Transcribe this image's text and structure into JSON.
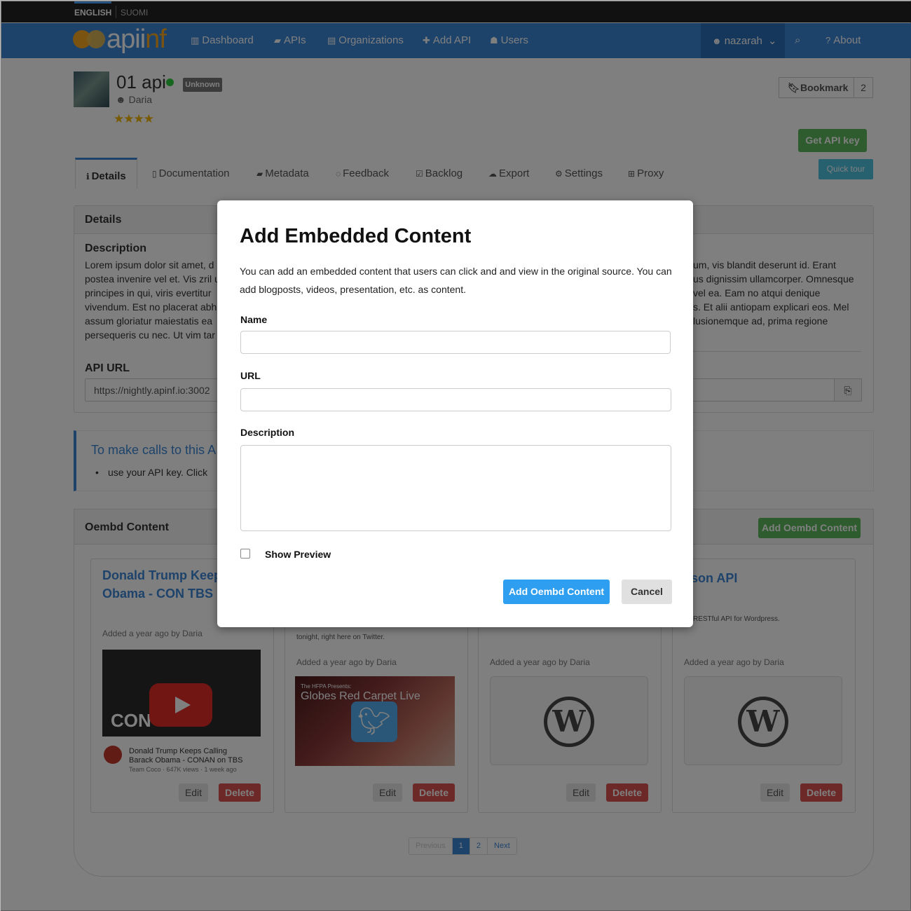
{
  "languages": {
    "english": "ENGLISH",
    "finnish": "SUOMI"
  },
  "brand": {
    "name_a": "api",
    "name_b": "nf",
    "accent": "#3d86d6"
  },
  "nav": {
    "dashboard": "Dashboard",
    "apis": "APIs",
    "organizations": "Organizations",
    "add_api": "Add API",
    "users": "Users",
    "user": "nazarah",
    "about": "About"
  },
  "api": {
    "title": "01 api",
    "status_badge": "Unknown",
    "owner": "Daria",
    "rating_stars": "★★★★",
    "bookmark_label": "Bookmark",
    "bookmark_count": "2",
    "get_key_label": "Get API key",
    "quick_tour_label": "Quick tour"
  },
  "tabs": {
    "details": "Details",
    "documentation": "Documentation",
    "metadata": "Metadata",
    "feedback": "Feedback",
    "backlog": "Backlog",
    "export": "Export",
    "settings": "Settings",
    "proxy": "Proxy"
  },
  "details": {
    "panel_title": "Details",
    "description_heading": "Description",
    "description_left": [
      "Lorem ipsum dolor sit amet, d",
      "postea invenire vel et. Vis zril u",
      "principes in qui, viris evertitur",
      "vivendum. Est no placerat abh",
      "assum gloriatur maiestatis ea",
      "persequeris cu nec. Ut vim tar"
    ],
    "description_right": [
      "um, vis blandit deserunt id. Erant",
      "us dignissim ullamcorper. Omnesque",
      "vel ea. Eam no atqui denique",
      "s. Et alii antiopam explicari eos. Mel",
      "lusionemque ad, prima regione"
    ],
    "api_url_heading": "API URL",
    "api_url_value": "https://nightly.apinf.io:3002"
  },
  "callout": {
    "title": "To make calls to this A",
    "item": "use your API key. Click"
  },
  "oembed": {
    "panel_title": "Oembd Content",
    "add_label": "Add Oembd Content",
    "cards": [
      {
        "title": "Donald Trump Keeps Barak Obama -  CON TBS",
        "meta": "Added a year ago by Daria",
        "video_title_1": "Donald Trump Keeps Calling",
        "video_title_2": "Barack Obama  - CONAN on TBS",
        "video_sub": "Team Coco · 647K views · 1 week ago",
        "thumb_text": "CON",
        "edit": "Edit",
        "delete": "Delete"
      },
      {
        "desc": "tonight, right here on Twitter.",
        "meta": "Added a year ago by Daria",
        "thumb_head": "The HFPA Presents:",
        "thumb_big": "Globes Red Carpet Live",
        "edit": "Edit",
        "delete": "Delete"
      },
      {
        "meta": "Added a year ago by Daria",
        "edit": "Edit",
        "delete": "Delete"
      },
      {
        "title": "son API",
        "desc": "RESTful API for Wordpress.",
        "meta": "Added a year ago by Daria",
        "edit": "Edit",
        "delete": "Delete"
      }
    ]
  },
  "pagination": {
    "prev": "Previous",
    "p1": "1",
    "p2": "2",
    "next": "Next"
  },
  "modal": {
    "title": "Add Embedded Content",
    "intro": "You can add an embedded content that users can click and  and view in the original source. You can add blogposts, videos, presentation, etc. as content.",
    "name_label": "Name",
    "name_value": "",
    "url_label": "URL",
    "url_value": "",
    "description_label": "Description",
    "description_value": "",
    "show_preview_label": "Show Preview",
    "submit_label": "Add Oembd Content",
    "cancel_label": "Cancel"
  }
}
